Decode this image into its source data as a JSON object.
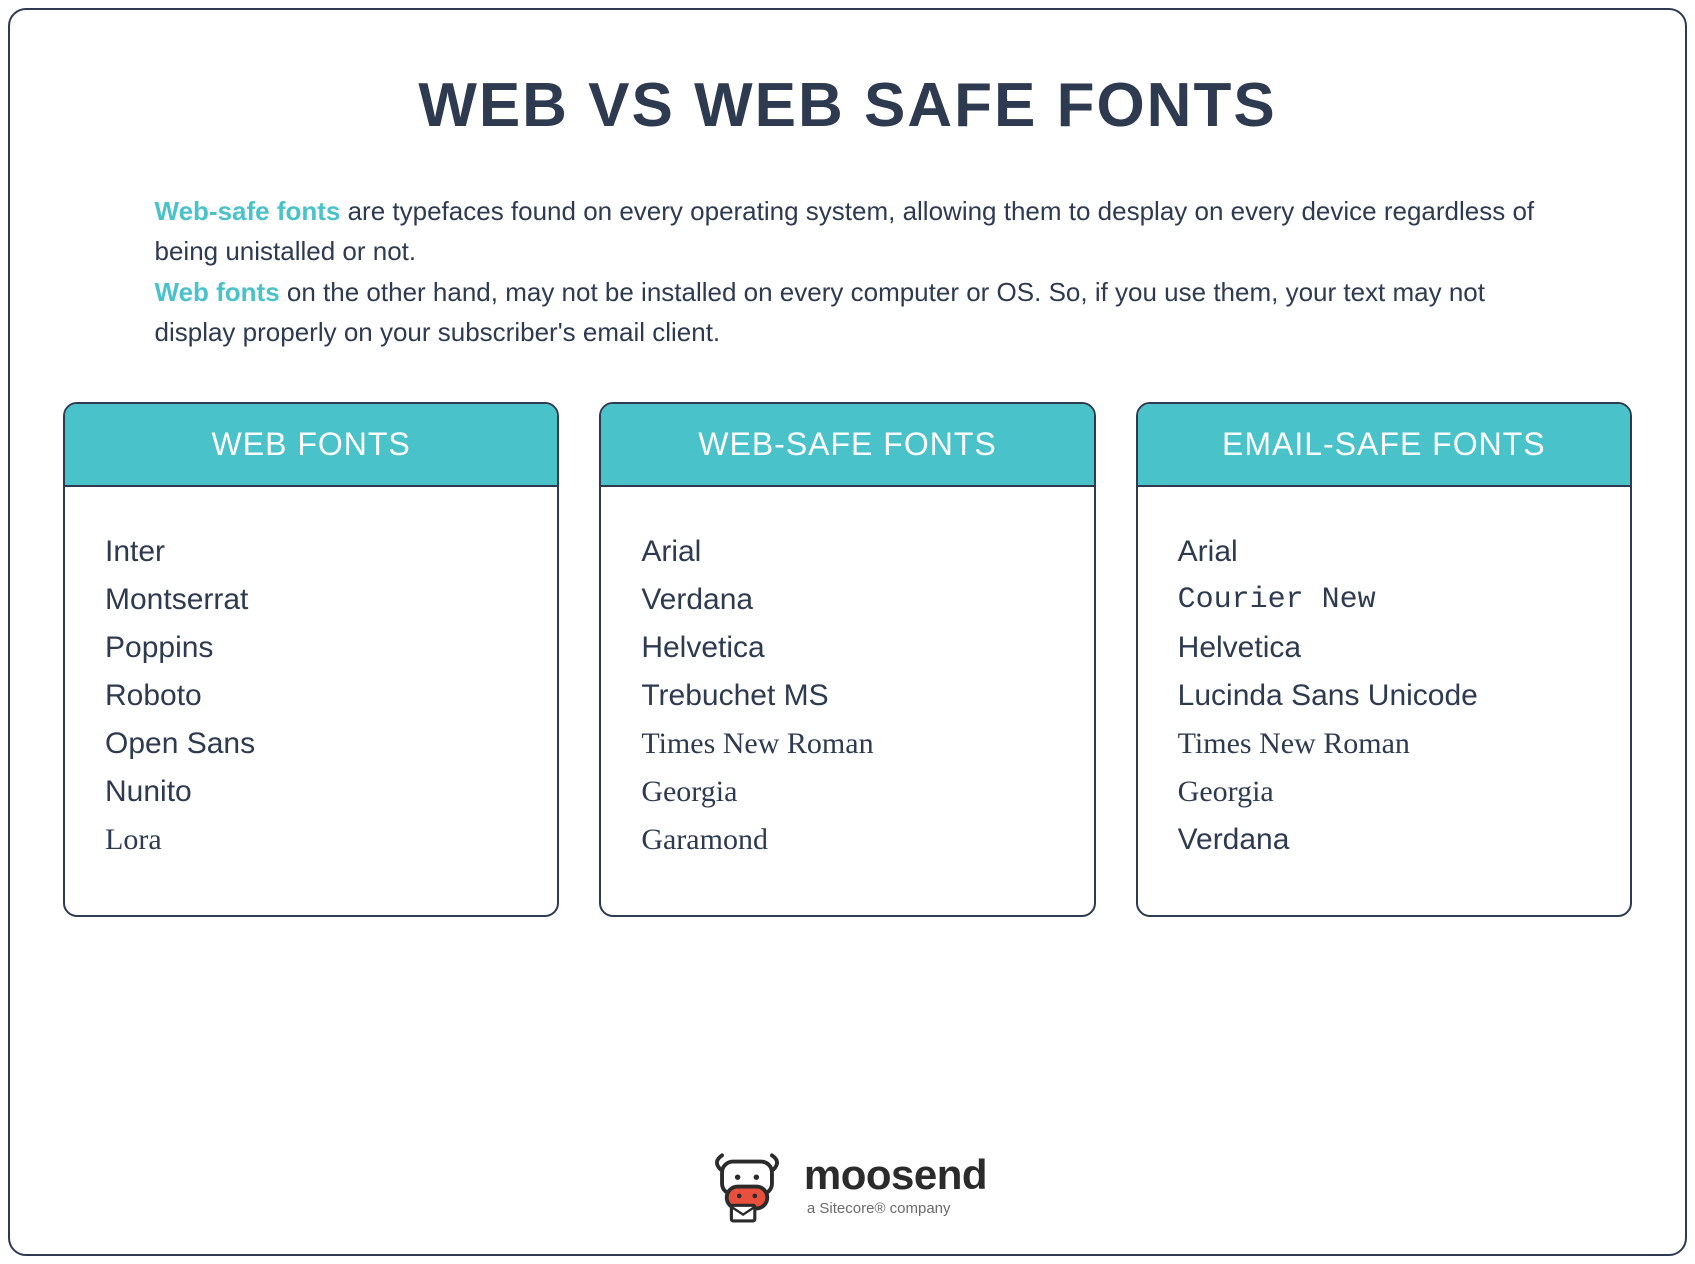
{
  "title": "WEB VS WEB SAFE FONTS",
  "description": {
    "kw1": "Web-safe fonts",
    "line1_rest": " are typefaces found on every operating system, allowing them to desplay on every device regardless of being unistalled or not.",
    "kw2": "Web fonts",
    "line2_rest": " on the other hand, may not be installed on every computer or OS. So, if you use them, your text may not display properly on your subscriber's email client."
  },
  "columns": [
    {
      "header": "WEB FONTS",
      "items": [
        {
          "label": "Inter",
          "class": "f-sans"
        },
        {
          "label": "Montserrat",
          "class": "f-sans"
        },
        {
          "label": "Poppins",
          "class": "f-sans"
        },
        {
          "label": "Roboto",
          "class": "f-sans"
        },
        {
          "label": "Open Sans",
          "class": "f-sans"
        },
        {
          "label": "Nunito",
          "class": "f-sans"
        },
        {
          "label": "Lora",
          "class": "f-lora"
        }
      ]
    },
    {
      "header": "WEB-SAFE FONTS",
      "items": [
        {
          "label": "Arial",
          "class": "f-sans"
        },
        {
          "label": "Verdana",
          "class": "f-verdana"
        },
        {
          "label": "Helvetica",
          "class": "f-sans"
        },
        {
          "label": "Trebuchet MS",
          "class": "f-trebuchet"
        },
        {
          "label": "Times New Roman",
          "class": "f-times"
        },
        {
          "label": "Georgia",
          "class": "f-georgia"
        },
        {
          "label": "Garamond",
          "class": "f-garamond"
        }
      ]
    },
    {
      "header": "EMAIL-SAFE FONTS",
      "items": [
        {
          "label": "Arial",
          "class": "f-sans"
        },
        {
          "label": "Courier New",
          "class": "f-courier"
        },
        {
          "label": "Helvetica",
          "class": "f-sans"
        },
        {
          "label": "Lucinda Sans Unicode",
          "class": "f-lucida"
        },
        {
          "label": "Times New Roman",
          "class": "f-times"
        },
        {
          "label": "Georgia",
          "class": "f-georgia"
        },
        {
          "label": "Verdana",
          "class": "f-verdana"
        }
      ]
    }
  ],
  "brand": {
    "name": "moosend",
    "tagline": "a Sitecore® company"
  }
}
